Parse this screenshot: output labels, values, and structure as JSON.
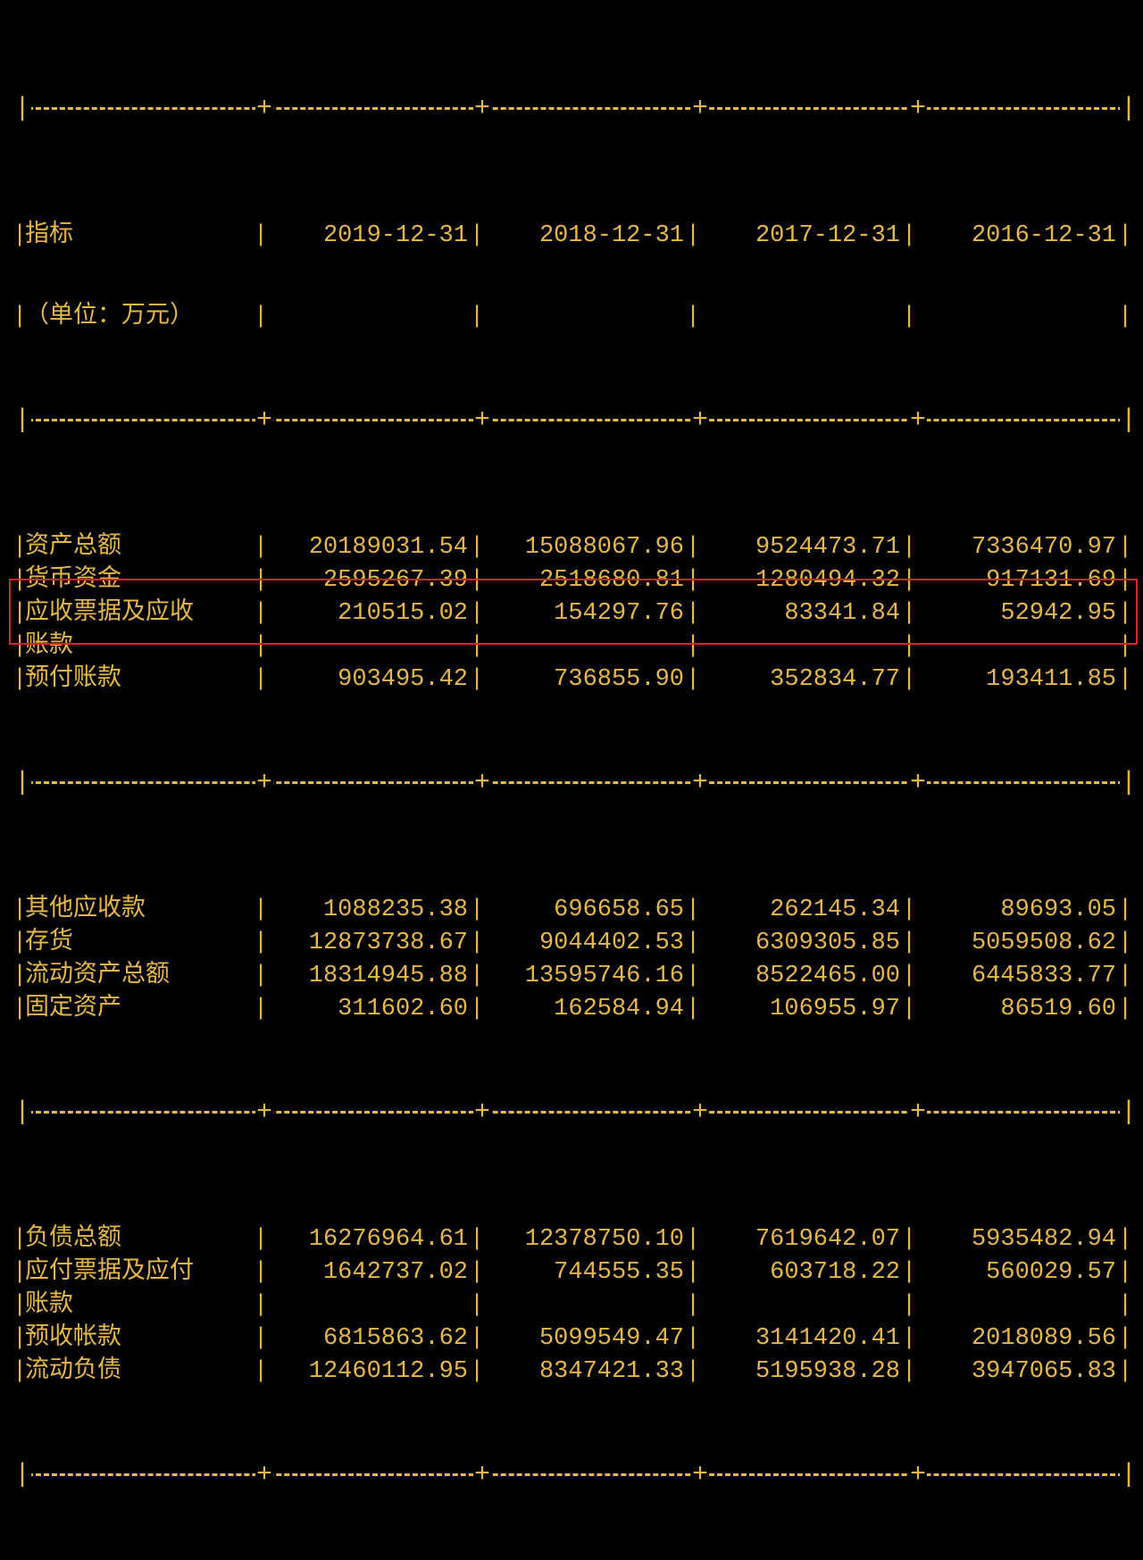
{
  "header": {
    "label_line1": "指标",
    "label_line2": "（单位：万元）",
    "col1": "2019-12-31",
    "col2": "2018-12-31",
    "col3": "2017-12-31",
    "col4": "2016-12-31"
  },
  "sectionA": [
    {
      "label": "资产总额",
      "v1": "20189031.54",
      "v2": "15088067.96",
      "v3": "9524473.71",
      "v4": "7336470.97"
    },
    {
      "label": "货币资金",
      "v1": "2595267.39",
      "v2": "2518680.81",
      "v3": "1280494.32",
      "v4": "917131.69"
    },
    {
      "label": "应收票据及应收",
      "label2": "账款",
      "v1": "210515.02",
      "v2": "154297.76",
      "v3": "83341.84",
      "v4": "52942.95"
    },
    {
      "label": "预付账款",
      "v1": "903495.42",
      "v2": "736855.90",
      "v3": "352834.77",
      "v4": "193411.85"
    }
  ],
  "sectionB": [
    {
      "label": "其他应收款",
      "v1": "1088235.38",
      "v2": "696658.65",
      "v3": "262145.34",
      "v4": "89693.05"
    },
    {
      "label": "存货",
      "v1": "12873738.67",
      "v2": "9044402.53",
      "v3": "6309305.85",
      "v4": "5059508.62"
    },
    {
      "label": "流动资产总额",
      "v1": "18314945.88",
      "v2": "13595746.16",
      "v3": "8522465.00",
      "v4": "6445833.77"
    },
    {
      "label": "固定资产",
      "v1": "311602.60",
      "v2": "162584.94",
      "v3": "106955.97",
      "v4": "86519.60"
    }
  ],
  "sectionC": [
    {
      "label": "负债总额",
      "v1": "16276964.61",
      "v2": "12378750.10",
      "v3": "7619642.07",
      "v4": "5935482.94",
      "highlight": true
    },
    {
      "label": "应付票据及应付",
      "label2": "账款",
      "v1": "1642737.02",
      "v2": "744555.35",
      "v3": "603718.22",
      "v4": "560029.57"
    },
    {
      "label": "预收帐款",
      "v1": "6815863.62",
      "v2": "5099549.47",
      "v3": "3141420.41",
      "v4": "2018089.56"
    },
    {
      "label": "流动负债",
      "v1": "12460112.95",
      "v2": "8347421.33",
      "v3": "5195938.28",
      "v4": "3947065.83"
    }
  ],
  "chart_data": {
    "type": "table",
    "title": "财务指标（单位：万元）",
    "columns": [
      "指标",
      "2019-12-31",
      "2018-12-31",
      "2017-12-31",
      "2016-12-31"
    ],
    "rows": [
      [
        "资产总额",
        20189031.54,
        15088067.96,
        9524473.71,
        7336470.97
      ],
      [
        "货币资金",
        2595267.39,
        2518680.81,
        1280494.32,
        917131.69
      ],
      [
        "应收票据及应收账款",
        210515.02,
        154297.76,
        83341.84,
        52942.95
      ],
      [
        "预付账款",
        903495.42,
        736855.9,
        352834.77,
        193411.85
      ],
      [
        "其他应收款",
        1088235.38,
        696658.65,
        262145.34,
        89693.05
      ],
      [
        "存货",
        12873738.67,
        9044402.53,
        6309305.85,
        5059508.62
      ],
      [
        "流动资产总额",
        18314945.88,
        13595746.16,
        8522465.0,
        6445833.77
      ],
      [
        "固定资产",
        311602.6,
        162584.94,
        106955.97,
        86519.6
      ],
      [
        "负债总额",
        16276964.61,
        12378750.1,
        7619642.07,
        5935482.94
      ],
      [
        "应付票据及应付账款",
        1642737.02,
        744555.35,
        603718.22,
        560029.57
      ],
      [
        "预收帐款",
        6815863.62,
        5099549.47,
        3141420.41,
        2018089.56
      ],
      [
        "流动负债",
        12460112.95,
        8347421.33,
        5195938.28,
        3947065.83
      ]
    ],
    "highlighted_row": "负债总额"
  }
}
